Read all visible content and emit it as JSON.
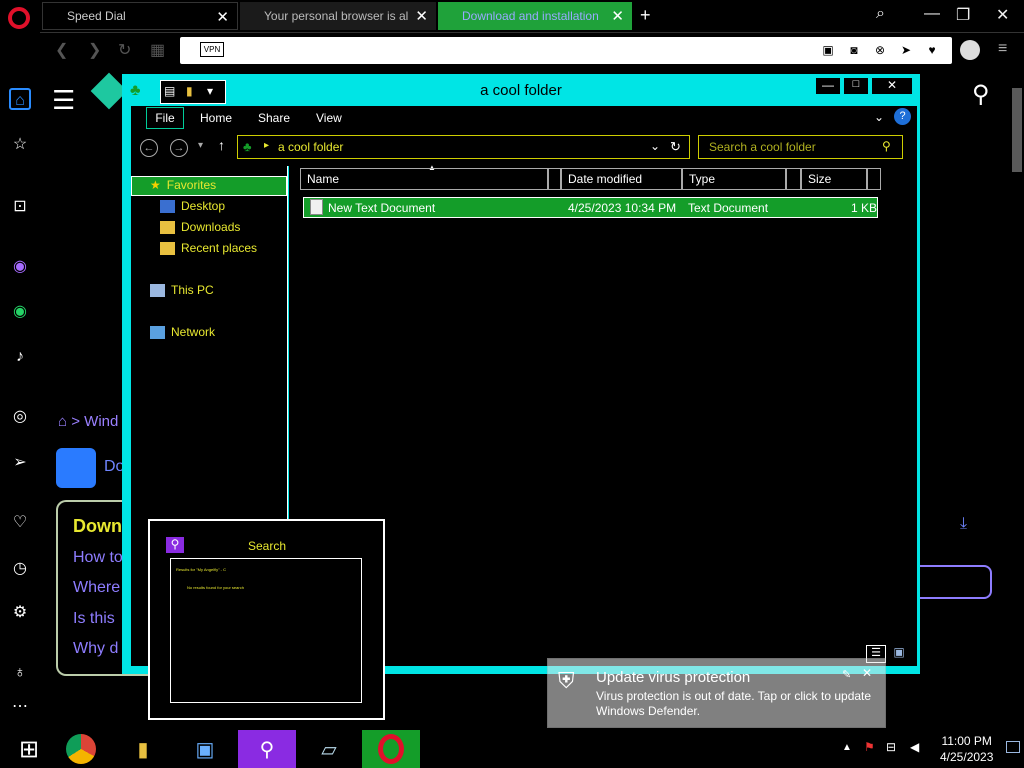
{
  "browser": {
    "tabs": [
      {
        "label": "Speed Dial"
      },
      {
        "label": "Your personal browser is al"
      },
      {
        "label": "Download and installation"
      }
    ],
    "vpn_badge": "VPN"
  },
  "webpage": {
    "breadcrumb": "Wind",
    "heading_fragment": "Do",
    "faq_heading": "Down",
    "faq_items": [
      "How to",
      "Where",
      "Is this",
      "Why d"
    ]
  },
  "explorer": {
    "title": "a cool folder",
    "ribbon_tabs": [
      "File",
      "Home",
      "Share",
      "View"
    ],
    "address": "a cool folder",
    "search_placeholder": "Search a cool folder",
    "nav": {
      "favorites": "Favorites",
      "desktop": "Desktop",
      "downloads": "Downloads",
      "recent": "Recent places",
      "thispc": "This PC",
      "network": "Network"
    },
    "columns": [
      "Name",
      "Date modified",
      "Type",
      "Size"
    ],
    "file": {
      "name": "New Text Document",
      "date": "4/25/2023 10:34 PM",
      "type": "Text Document",
      "size": "1 KB"
    }
  },
  "search_popup": {
    "title": "Search",
    "line1": "Results for \"My Angelfly\" - C",
    "line2": "No results found for your search"
  },
  "notification": {
    "title": "Update virus protection",
    "body": "Virus protection is out of date. Tap or click to update Windows Defender."
  },
  "taskbar": {
    "time": "11:00 PM",
    "date": "4/25/2023"
  }
}
